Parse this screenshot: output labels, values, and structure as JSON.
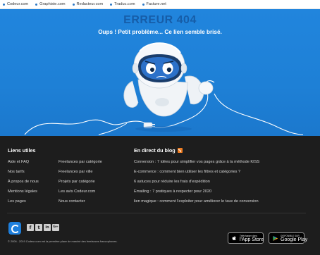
{
  "network_bar": {
    "links": [
      "Codeur.com",
      "Graphiste.com",
      "Redacteur.com",
      "Traduc.com",
      "Facture.net"
    ]
  },
  "hero": {
    "title": "ERREUR 404",
    "subtitle": "Oups ! Petit problème... Ce lien semble brisé."
  },
  "footer": {
    "useful_links_title": "Liens utiles",
    "useful_col1": [
      "Aide et FAQ",
      "Nos tarifs",
      "À propos de nous",
      "Mentions légales",
      "Les pages"
    ],
    "useful_col2": [
      "Freelances par catégorie",
      "Freelances par ville",
      "Projets par catégorie",
      "Les avis Codeur.com",
      "Nous contacter"
    ],
    "blog_title": "En direct du blog",
    "blog_posts": [
      "Conversion : 7 idées pour simplifier vos pages grâce à la méthode KISS",
      "E-commerce : comment bien utiliser les filtres et catégories ?",
      "6 astuces pour réduire les frais d’expédition",
      "Emailing : 7 pratiques à respecter pour 2020",
      "lien magique : comment l’exploiter pour améliorer le taux de conversion"
    ],
    "social": [
      {
        "icon": "facebook-icon",
        "glyph": "f"
      },
      {
        "icon": "twitter-icon",
        "glyph": "t"
      },
      {
        "icon": "linkedin-icon",
        "glyph": "in"
      },
      {
        "icon": "google-plus-icon",
        "glyph": "G+"
      }
    ],
    "copyright": "© 2006 - 2019 Codeur.com est la première place de marché des freelances francophones.",
    "app_store": {
      "small": "Télécharger dans",
      "big": "l'App Store"
    },
    "google_play": {
      "small": "DISPONIBLE SUR",
      "big": "Google Play"
    }
  },
  "colors": {
    "hero_blue": "#1f7fd6",
    "title_blue": "#165da8",
    "footer_bg": "#1d1d1d",
    "rss_orange": "#ef7d22"
  }
}
